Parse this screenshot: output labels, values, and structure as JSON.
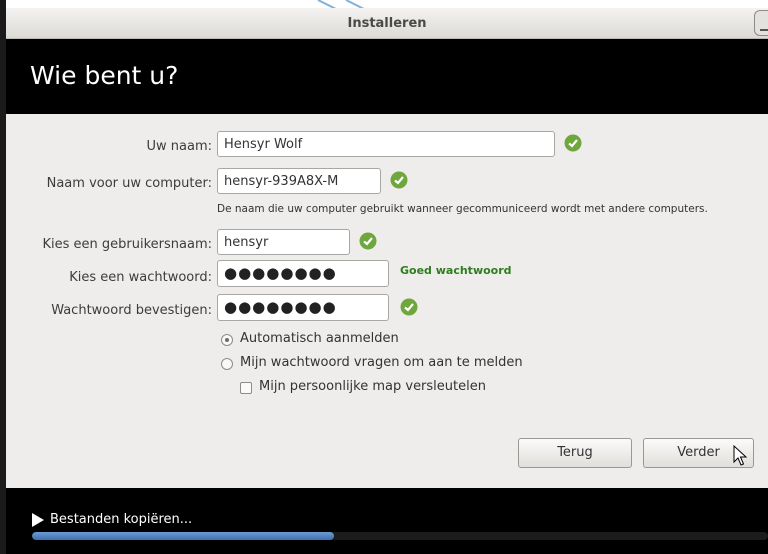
{
  "window": {
    "title": "Installeren"
  },
  "header": {
    "title": "Wie bent u?"
  },
  "form": {
    "name_label": "Uw naam:",
    "name_value": "Hensyr Wolf",
    "computer_label": "Naam voor uw computer:",
    "computer_value": "hensyr-939A8X-M",
    "computer_hint": "De naam die uw computer gebruikt wanneer gecommuniceerd wordt met andere computers.",
    "username_label": "Kies een gebruikersnaam:",
    "username_value": "hensyr",
    "password_label": "Kies een wachtwoord:",
    "password_value": "●●●●●●●●",
    "password_strength": "Goed wachtwoord",
    "confirm_label": "Wachtwoord bevestigen:",
    "confirm_value": "●●●●●●●●"
  },
  "options": {
    "auto_login": "Automatisch aanmelden",
    "ask_password": "Mijn wachtwoord vragen om aan te melden",
    "encrypt_home": "Mijn persoonlijke map versleutelen",
    "auto_login_selected": true,
    "encrypt_home_checked": false
  },
  "buttons": {
    "back": "Terug",
    "forward": "Verder"
  },
  "footer": {
    "status": "Bestanden kopiëren...",
    "progress_fraction": 0.41
  },
  "colors": {
    "check_green": "#6fa63d",
    "strength_green": "#2e7d1f",
    "progress_blue": "#4f7fc0"
  }
}
